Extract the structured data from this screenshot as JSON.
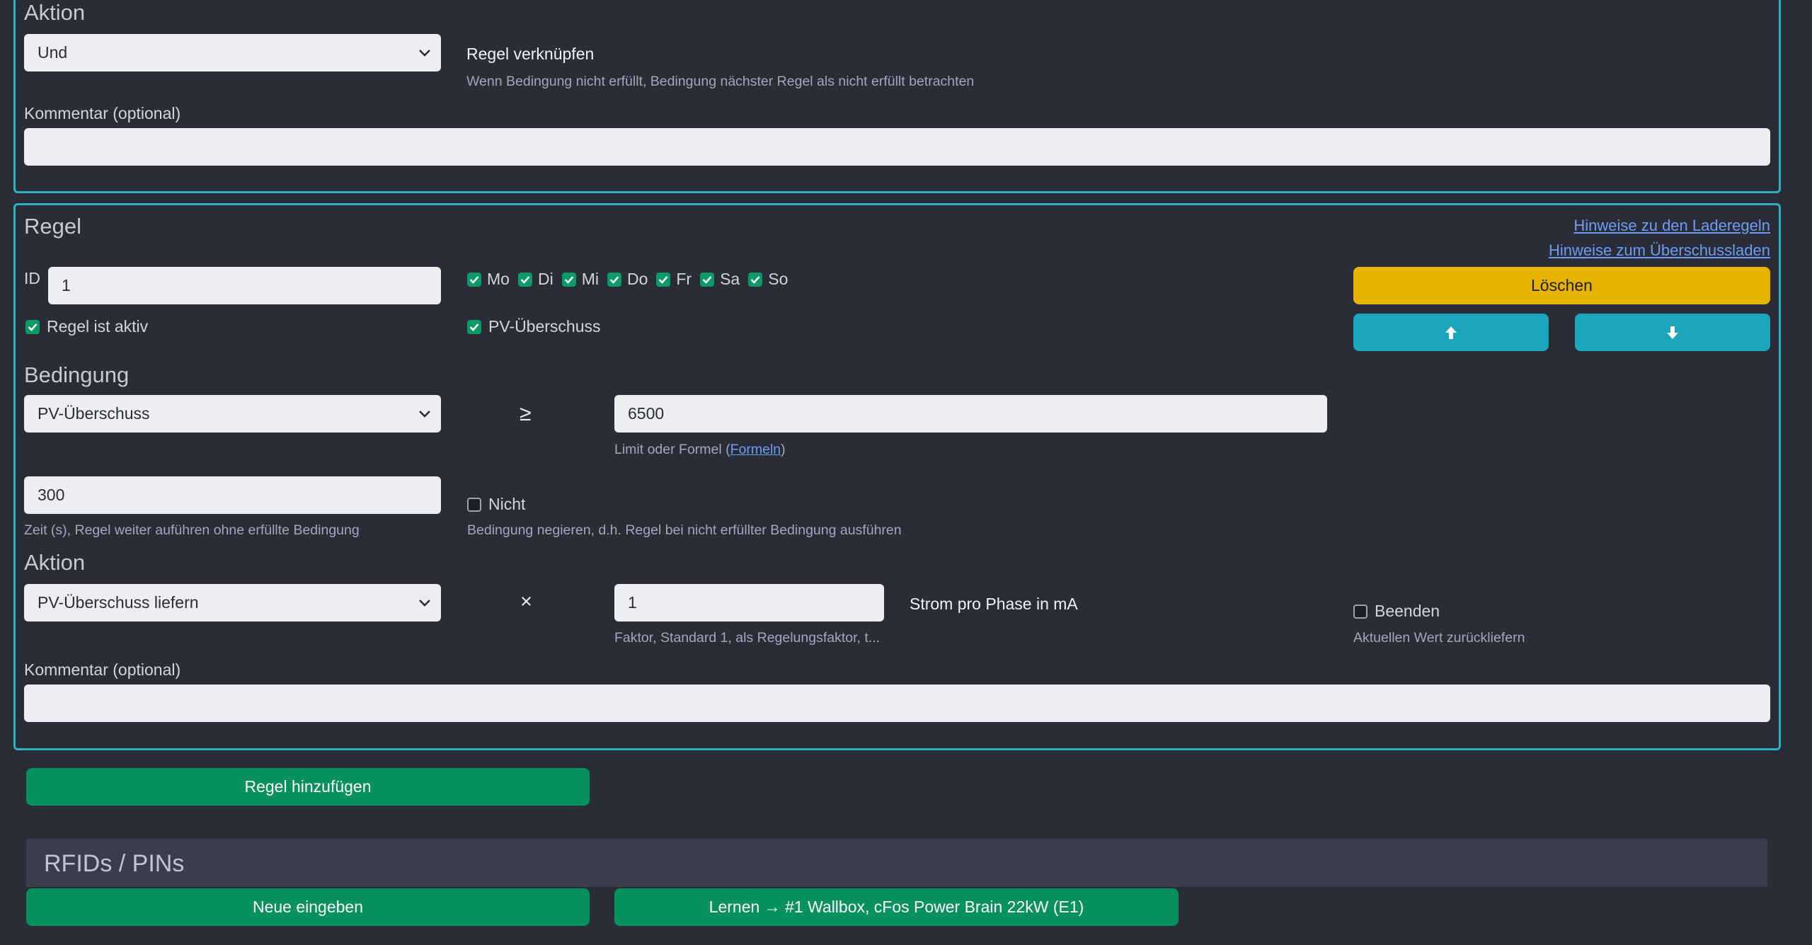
{
  "top_section": {
    "heading": "Aktion",
    "select_value": "Und",
    "link_label": "Regel verknüpfen",
    "link_hint": "Wenn Bedingung nicht erfüllt, Bedingung nächster Regel als nicht erfüllt betrachten",
    "comment_label": "Kommentar (optional)",
    "comment_value": ""
  },
  "rule": {
    "heading": "Regel",
    "help_links": [
      "Hinweise zu den Laderegeln",
      "Hinweise zum Überschussladen"
    ],
    "id_label": "ID",
    "id_value": "1",
    "days": [
      {
        "label": "Mo",
        "checked": true
      },
      {
        "label": "Di",
        "checked": true
      },
      {
        "label": "Mi",
        "checked": true
      },
      {
        "label": "Do",
        "checked": true
      },
      {
        "label": "Fr",
        "checked": true
      },
      {
        "label": "Sa",
        "checked": true
      },
      {
        "label": "So",
        "checked": true
      }
    ],
    "active_label": "Regel ist aktiv",
    "active_checked": true,
    "pv_label": "PV-Überschuss",
    "pv_checked": true,
    "delete_label": "Löschen",
    "up_icon": "arrow-up-icon",
    "down_icon": "arrow-down-icon",
    "condition": {
      "heading": "Bedingung",
      "select_value": "PV-Überschuss",
      "operator": "≥",
      "limit_value": "6500",
      "limit_hint_prefix": "Limit oder Formel (",
      "limit_hint_link": "Formeln",
      "limit_hint_suffix": ")",
      "time_value": "300",
      "time_hint": "Zeit (s), Regel weiter auführen ohne erfüllte Bedingung",
      "not_label": "Nicht",
      "not_checked": false,
      "not_hint": "Bedingung negieren, d.h. Regel bei nicht erfüllter Bedingung ausführen"
    },
    "action": {
      "heading": "Aktion",
      "select_value": "PV-Überschuss liefern",
      "operator": "×",
      "factor_value": "1",
      "factor_hint": "Faktor, Standard 1, als Regelungsfaktor, t...",
      "unit_label": "Strom pro Phase in mA",
      "end_label": "Beenden",
      "end_checked": false,
      "end_hint": "Aktuellen Wert zurückliefern"
    },
    "comment_label": "Kommentar (optional)",
    "comment_value": ""
  },
  "add_rule_label": "Regel hinzufügen",
  "rfid": {
    "heading": "RFIDs / PINs",
    "new_label": "Neue eingeben",
    "learn_label": "Lernen → #1 Wallbox, cFos Power Brain 22kW (E1)"
  },
  "colors": {
    "background": "#2a2c38",
    "border": "#2bb3c0",
    "green": "#06915e",
    "yellow": "#e8b300",
    "teal": "#1ba6bd",
    "link": "#6d9cf0"
  }
}
